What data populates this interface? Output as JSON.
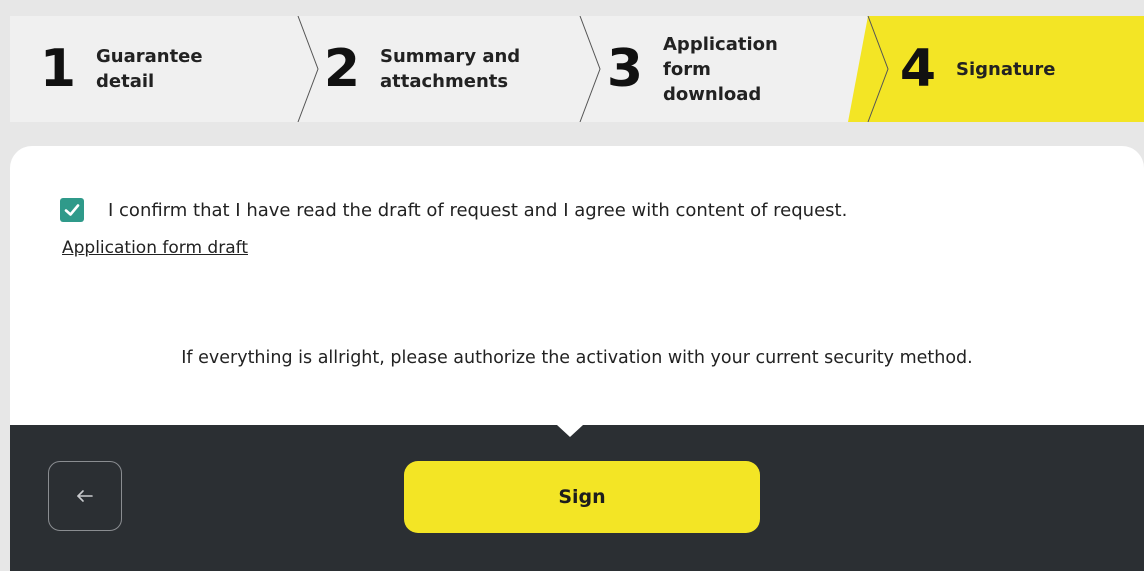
{
  "stepper": {
    "steps": [
      {
        "number": "1",
        "label": "Guarantee\ndetail",
        "active": false
      },
      {
        "number": "2",
        "label": "Summary and\nattachments",
        "active": false
      },
      {
        "number": "3",
        "label": "Application\nform\ndownload",
        "active": false
      },
      {
        "number": "4",
        "label": "Signature",
        "active": true
      }
    ],
    "active_color": "#f3e525",
    "inactive_color": "#f0f0f0"
  },
  "confirmation": {
    "checked": true,
    "text": "I confirm that I have read the draft of request and I agree with content of request.",
    "link_label": "Application form draft"
  },
  "authorize_text": "If everything is allright, please authorize the activation with your current security method.",
  "footer": {
    "back_icon": "arrow-left-icon",
    "sign_label": "Sign"
  },
  "colors": {
    "accent_yellow": "#f3e525",
    "checkbox_teal": "#2f9a8a",
    "footer_dark": "#2b2f33"
  }
}
